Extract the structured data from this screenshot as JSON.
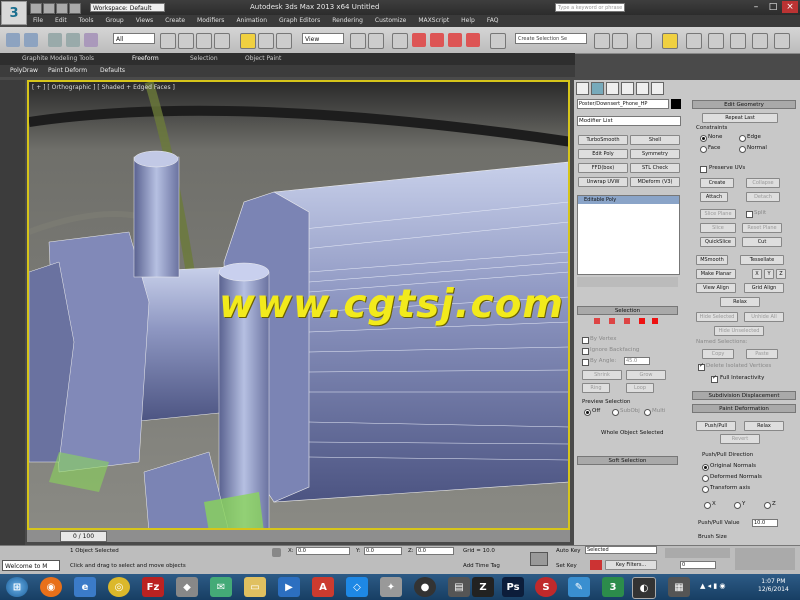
{
  "titlebar": {
    "workspace": "Workspace: Default",
    "title": "Autodesk 3ds Max 2013 x64     Untitled",
    "search_placeholder": "Type a keyword or phrase"
  },
  "menubar": [
    "File",
    "Edit",
    "Tools",
    "Group",
    "Views",
    "Create",
    "Modifiers",
    "Animation",
    "Graph Editors",
    "Rendering",
    "Customize",
    "MAXScript",
    "Help",
    "FAQ"
  ],
  "toolbar": {
    "selection_filter": "All",
    "reference_coord": "View",
    "named_selection": "Create Selection Se"
  },
  "ribbon": {
    "tabs": [
      "Graphite Modeling Tools",
      "Freeform",
      "Selection",
      "Object Paint"
    ],
    "subtabs": [
      "PolyDraw",
      "Paint Deform",
      "Defaults"
    ]
  },
  "viewport": {
    "label": "[ + ] [ Orthographic ] [ Shaded + Edged Faces ]",
    "watermark": "www.cgtsj.com"
  },
  "command_panel": {
    "object_name": "Poster/Downsert_Phone_HP",
    "modifier_list": "Modifier List",
    "modifier_buttons": [
      "TurboSmooth",
      "Shell",
      "Edit Poly",
      "Symmetry",
      "FFD(box)",
      "STL Check",
      "Unwrap UVW",
      "MDeform (V3)"
    ],
    "stack_item": "Editable Poly",
    "selection": {
      "header": "Selection",
      "by_vertex": "By Vertex",
      "ignore_backfacing": "Ignore Backfacing",
      "by_angle": "By Angle:",
      "angle_value": "45.0",
      "shrink": "Shrink",
      "grow": "Grow",
      "ring": "Ring",
      "loop": "Loop",
      "preview_selection": "Preview Selection",
      "off": "Off",
      "subobj": "SubObj",
      "multi": "Multi",
      "whole_object": "Whole Object Selected"
    },
    "soft_selection": "Soft Selection",
    "edit_geometry": {
      "header": "Edit Geometry",
      "repeat_last": "Repeat Last",
      "constraints": "Constraints",
      "none": "None",
      "edge": "Edge",
      "face": "Face",
      "normal": "Normal",
      "preserve_uvs": "Preserve UVs",
      "create": "Create",
      "collapse": "Collapse",
      "attach": "Attach",
      "detach": "Detach",
      "slice_plane": "Slice Plane",
      "split": "Split",
      "slice": "Slice",
      "reset_plane": "Reset Plane",
      "quickslice": "QuickSlice",
      "cut": "Cut",
      "msmooth": "MSmooth",
      "tessellate": "Tessellate",
      "make_planar": "Make Planar",
      "x": "X",
      "y": "Y",
      "z": "Z",
      "view_align": "View Align",
      "grid_align": "Grid Align",
      "relax": "Relax",
      "hide_selected": "Hide Selected",
      "unhide_all": "Unhide All",
      "hide_unselected": "Hide Unselected",
      "named_selections": "Named Selections:",
      "copy": "Copy",
      "paste": "Paste",
      "delete_isolated": "Delete Isolated Vertices",
      "full_interactivity": "Full Interactivity"
    },
    "subdivision_displacement": "Subdivision Displacement",
    "paint_deformation": {
      "header": "Paint Deformation",
      "push_pull": "Push/Pull",
      "relax": "Relax",
      "revert": "Revert",
      "direction": "Push/Pull Direction",
      "original_normals": "Original Normals",
      "deformed_normals": "Deformed Normals",
      "transform_axis": "Transform axis",
      "x": "X",
      "y": "Y",
      "z": "Z",
      "value_label": "Push/Pull Value",
      "value": "10.0",
      "brush_size": "Brush Size"
    }
  },
  "timeline": {
    "frame": "0 / 100"
  },
  "status": {
    "maxscript": "Welcome to M",
    "objects_selected": "1 Object Selected",
    "prompt": "Click and drag to select and move objects",
    "x_label": "X:",
    "x": "0.0",
    "y_label": "Y:",
    "y": "0.0",
    "z_label": "Z:",
    "z": "0.0",
    "grid": "Grid = 10.0",
    "add_time_tag": "Add Time Tag",
    "auto_key": "Auto Key",
    "set_key": "Set Key",
    "key_mode": "Selected",
    "key_filters": "Key Filters...",
    "frame_field": "0"
  },
  "taskbar": {
    "time": "1:07 PM",
    "date": "12/6/2014"
  }
}
